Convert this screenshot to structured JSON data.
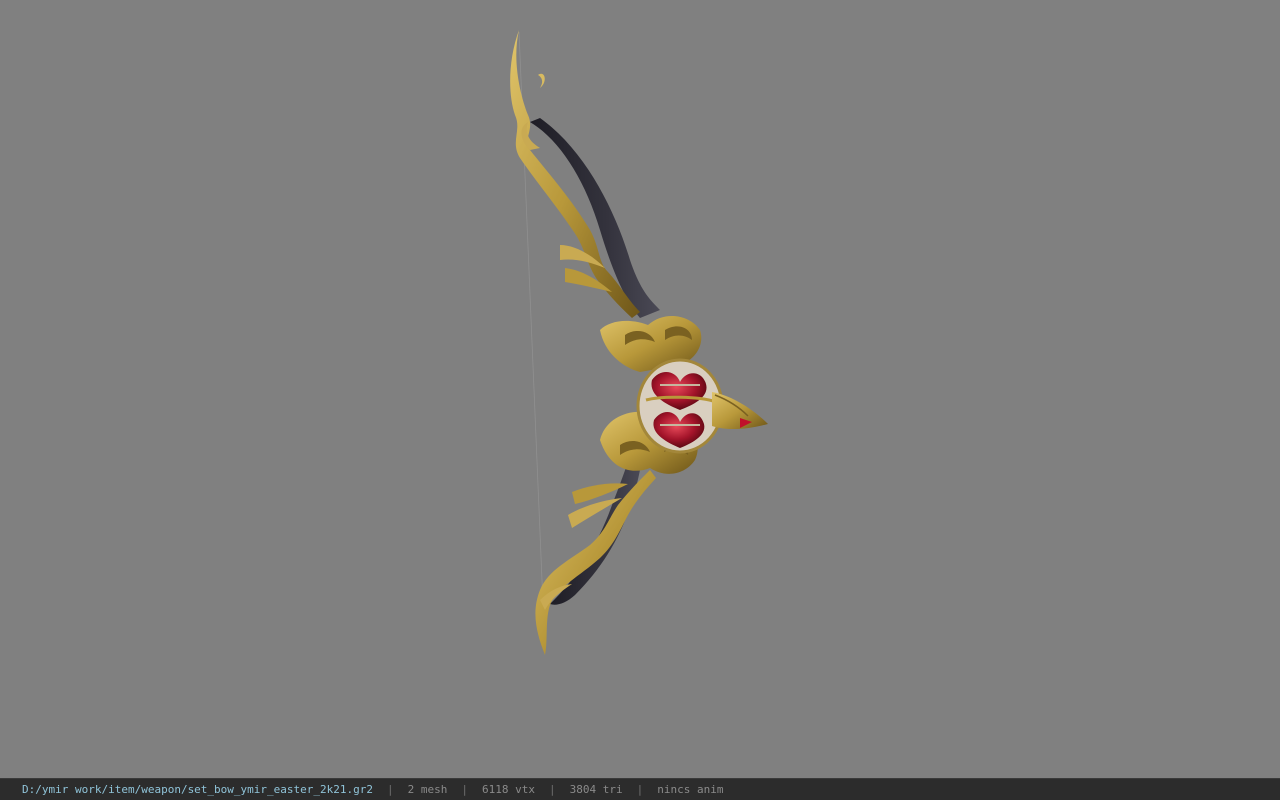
{
  "viewer": {
    "background_color": "#808080",
    "model_name": "set_bow_ymir_easter_2k21"
  },
  "status_bar": {
    "file_path": "D:/ymir work/item/weapon/set_bow_ymir_easter_2k21.gr2",
    "separator": "|",
    "mesh_count": "2 mesh",
    "vertex_count": "6118 vtx",
    "triangle_count": "3804 tri",
    "animation_status": "nincs anim"
  },
  "colors": {
    "gold": "#b8983a",
    "gold_dark": "#7a6121",
    "limb_dark": "#2b2a33",
    "gem_red": "#b0182a",
    "path_text": "#8fc3d8"
  }
}
